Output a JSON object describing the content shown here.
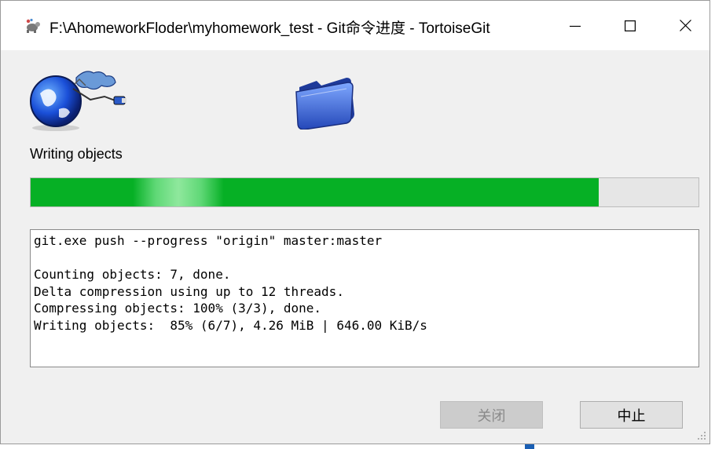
{
  "window": {
    "title": "F:\\AhomeworkFloder\\myhomework_test - Git命令进度 - TortoiseGit",
    "title_icon": "tortoisegit-icon",
    "controls": {
      "minimize": "—",
      "maximize": "☐",
      "close": "✕"
    }
  },
  "animation": {
    "left_icon": "globe-network-icon",
    "right_icon": "folder-icon"
  },
  "status": {
    "label": "Writing objects",
    "progress_percent": 85
  },
  "log": {
    "lines": [
      "git.exe push --progress \"origin\" master:master",
      "",
      "Counting objects: 7, done.",
      "Delta compression using up to 12 threads.",
      "Compressing objects: 100% (3/3), done.",
      "Writing objects:  85% (6/7), 4.26 MiB | 646.00 KiB/s"
    ]
  },
  "buttons": {
    "close_label": "关闭",
    "close_enabled": false,
    "abort_label": "中止"
  },
  "colors": {
    "progress_fill": "#06b025",
    "progress_track": "#e6e6e6",
    "window_bg": "#f0f0f0"
  }
}
